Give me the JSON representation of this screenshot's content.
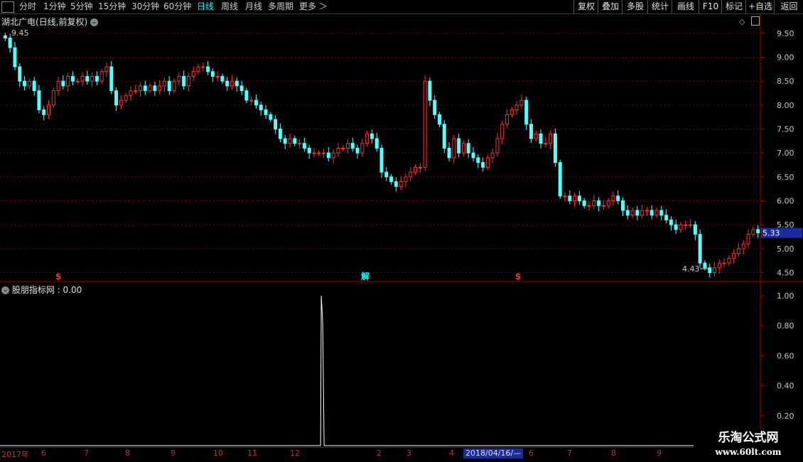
{
  "toolbar": {
    "periods": [
      {
        "label": "分时",
        "active": false
      },
      {
        "label": "1分钟",
        "active": false
      },
      {
        "label": "5分钟",
        "active": false
      },
      {
        "label": "15分钟",
        "active": false
      },
      {
        "label": "30分钟",
        "active": false
      },
      {
        "label": "60分钟",
        "active": false
      },
      {
        "label": "日线",
        "active": true
      },
      {
        "label": "周线",
        "active": false
      },
      {
        "label": "月线",
        "active": false
      },
      {
        "label": "多周期",
        "active": false
      },
      {
        "label": "更多 ＞",
        "active": false
      }
    ],
    "buttons": [
      "复权",
      "叠加",
      "多股",
      "统计",
      "画线",
      "F10",
      "标记",
      "+自选",
      "返回"
    ]
  },
  "stock_title": "湖北广电(日线,前复权)",
  "indicator": {
    "title": "股朋指标网 : 0.00"
  },
  "chart_data": [
    {
      "type": "candlestick",
      "title": "湖北广电(日线,前复权)",
      "y_ticks": [
        9.5,
        9.0,
        8.5,
        8.0,
        7.5,
        7.0,
        6.5,
        6.0,
        5.5,
        5.0,
        4.5
      ],
      "y_tick_labels": [
        "9.50",
        "9.00",
        "8.50",
        "8.00",
        "7.50",
        "7.00",
        "6.50",
        "6.00",
        "5.50",
        "5.00",
        "4.50"
      ],
      "ylim": [
        4.33,
        9.75
      ],
      "high_label": "9.45",
      "low_label": "4.43",
      "current_price": "5.33",
      "markers": [
        "$",
        "解",
        "$"
      ],
      "closes": [
        9.4,
        9.2,
        8.8,
        8.5,
        8.4,
        8.5,
        8.3,
        7.9,
        7.8,
        8.0,
        8.3,
        8.5,
        8.4,
        8.6,
        8.5,
        8.5,
        8.6,
        8.5,
        8.6,
        8.5,
        8.7,
        8.8,
        8.3,
        8.0,
        8.1,
        8.2,
        8.3,
        8.3,
        8.4,
        8.3,
        8.4,
        8.3,
        8.4,
        8.5,
        8.3,
        8.5,
        8.6,
        8.4,
        8.6,
        8.7,
        8.8,
        8.8,
        8.7,
        8.6,
        8.6,
        8.5,
        8.4,
        8.5,
        8.4,
        8.3,
        8.1,
        8.1,
        8.0,
        7.9,
        7.8,
        7.7,
        7.5,
        7.3,
        7.2,
        7.3,
        7.2,
        7.2,
        7.1,
        7.0,
        7.0,
        7.0,
        7.0,
        6.9,
        7.0,
        7.1,
        7.1,
        7.2,
        7.1,
        7.0,
        7.2,
        7.4,
        7.3,
        7.1,
        6.6,
        6.5,
        6.4,
        6.3,
        6.4,
        6.5,
        6.6,
        6.7,
        6.7,
        8.5,
        8.1,
        7.8,
        7.6,
        7.1,
        6.9,
        7.3,
        7.0,
        7.2,
        7.0,
        6.9,
        6.8,
        6.7,
        6.9,
        7.0,
        7.3,
        7.6,
        7.8,
        7.9,
        8.0,
        8.1,
        7.6,
        7.3,
        7.4,
        7.2,
        7.2,
        7.4,
        6.8,
        6.1,
        6.1,
        6.0,
        6.1,
        6.0,
        5.9,
        5.9,
        6.0,
        5.9,
        5.9,
        6.0,
        6.1,
        6.0,
        5.8,
        5.7,
        5.8,
        5.7,
        5.8,
        5.8,
        5.7,
        5.8,
        5.7,
        5.6,
        5.5,
        5.4,
        5.5,
        5.5,
        5.5,
        5.3,
        4.7,
        4.6,
        4.5,
        4.6,
        4.7,
        4.7,
        4.8,
        4.9,
        5.0,
        5.1,
        5.3,
        5.4,
        5.33
      ]
    },
    {
      "type": "line",
      "title": "股朋指标网",
      "value_label": "0.00",
      "y_tick_labels": [
        "1.00",
        "0.80",
        "0.60",
        "0.40",
        "0.20"
      ],
      "ylim": [
        0,
        1.0
      ],
      "values": [
        0,
        0,
        0,
        0,
        0,
        0,
        0,
        0,
        0,
        0,
        0,
        0,
        0,
        0,
        0,
        0,
        0,
        0,
        0,
        0,
        0,
        0,
        0,
        0,
        0,
        0,
        0,
        0,
        0,
        0,
        0,
        0,
        0,
        0,
        0,
        0,
        0,
        0,
        0,
        0,
        0,
        0,
        0,
        0,
        0,
        0,
        0,
        0,
        0,
        0,
        0,
        0,
        0,
        0,
        0,
        0,
        0,
        0,
        0,
        0,
        0,
        0,
        0,
        0,
        0,
        0,
        0,
        0,
        0,
        0,
        0,
        0,
        0,
        0,
        0,
        0,
        0,
        0,
        0,
        0,
        0,
        0,
        0,
        0,
        0,
        0,
        0,
        0,
        0,
        0,
        0,
        0,
        0,
        0,
        0,
        0,
        0,
        0,
        0,
        0,
        0,
        0,
        0,
        0,
        0,
        0,
        0,
        0,
        0,
        0,
        0,
        0,
        0,
        0,
        0,
        0,
        0,
        0,
        0,
        0,
        0,
        0,
        0,
        0,
        0,
        0,
        0,
        0,
        0,
        0,
        0,
        0,
        0,
        0,
        0,
        0,
        0,
        0,
        0,
        0,
        0,
        0,
        0,
        0,
        0,
        0,
        0,
        0,
        0,
        0,
        0,
        0,
        0,
        0,
        0,
        0,
        0,
        0,
        0,
        0,
        0,
        0,
        0,
        0,
        0,
        0,
        0,
        0,
        0,
        0,
        0,
        0,
        0,
        0,
        0
      ],
      "spikes": [
        {
          "index": 66,
          "value": 1.0
        },
        {
          "index": 67,
          "value": 0.82
        }
      ]
    }
  ],
  "date_axis": {
    "labels": [
      "2017年",
      "6",
      "7",
      "8",
      "9",
      "10",
      "11",
      "12",
      "2",
      "3",
      "4",
      "2018/04/16/—",
      "6",
      "7",
      "8",
      "9"
    ],
    "highlight": "2018/04/16/—"
  },
  "watermark": {
    "line1": "乐淘公式网",
    "line2": "www.60lt.com"
  }
}
